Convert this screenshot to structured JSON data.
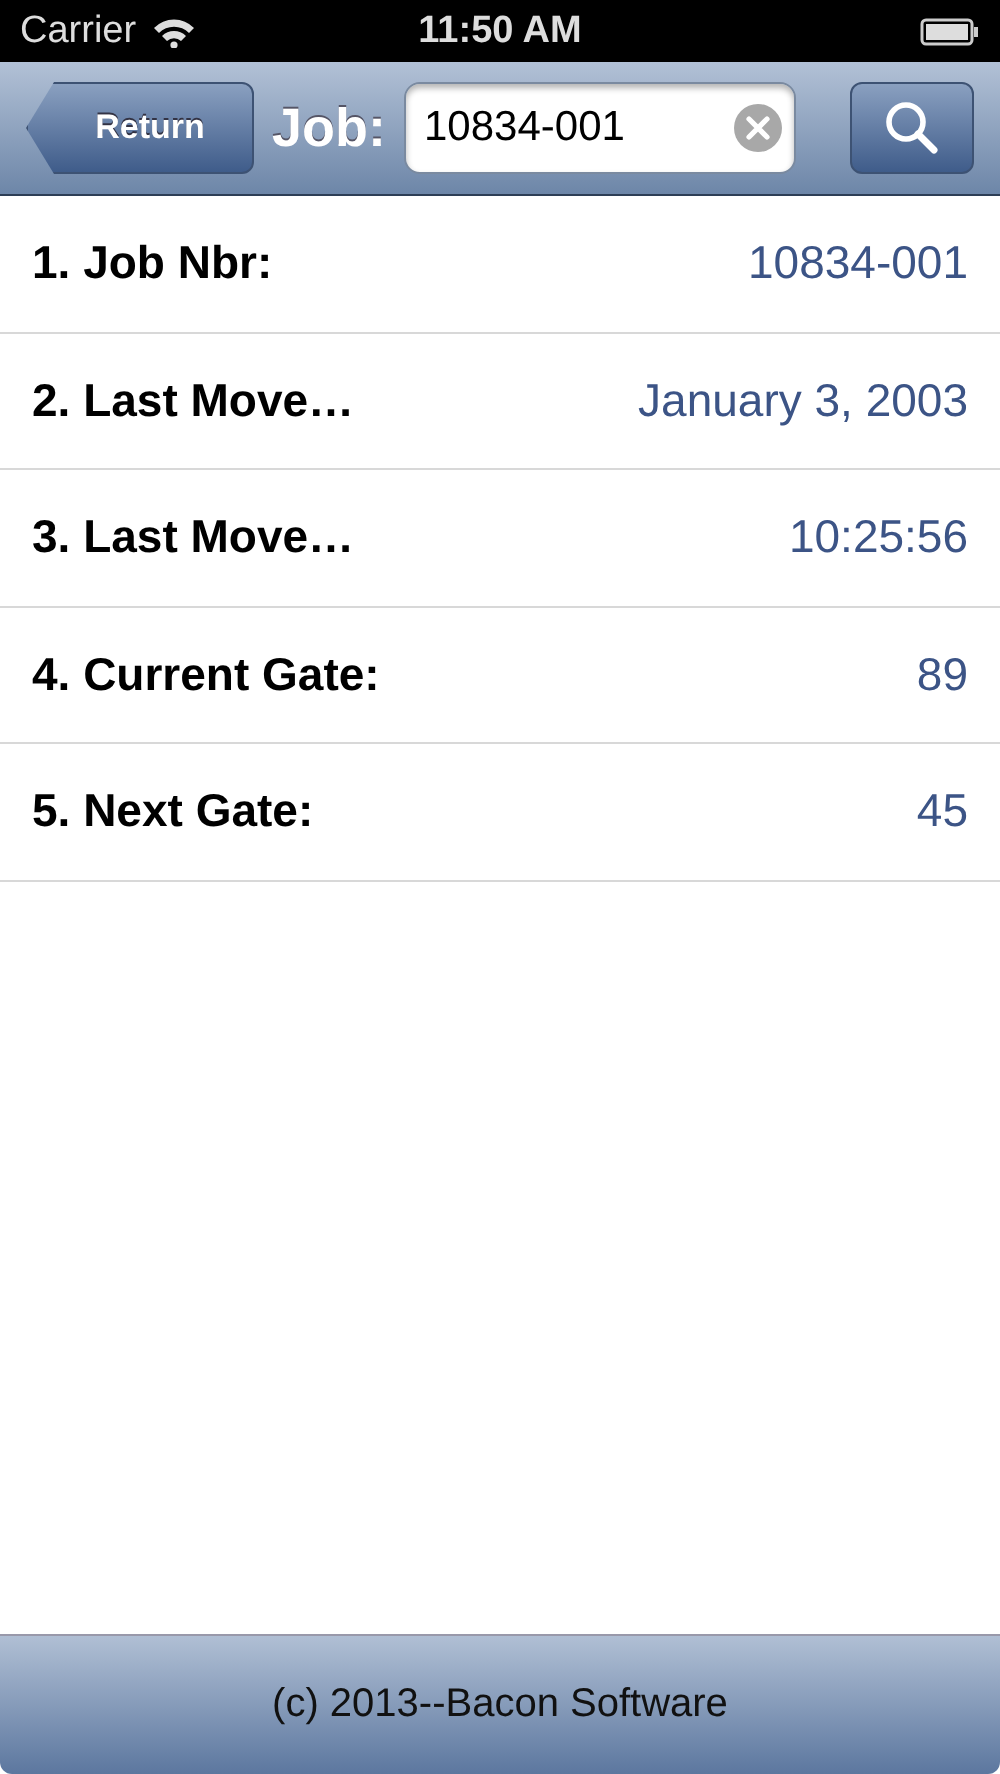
{
  "status_bar": {
    "carrier": "Carrier",
    "time": "11:50 AM"
  },
  "nav_bar": {
    "back_button": "Return",
    "label": "Job:",
    "search_field": {
      "value": "10834-001"
    }
  },
  "rows": [
    {
      "label": "1. Job Nbr:",
      "value": "10834-001"
    },
    {
      "label": "2. Last Move…",
      "value": "January 3, 2003"
    },
    {
      "label": "3. Last Move…",
      "value": "10:25:56"
    },
    {
      "label": "4. Current Gate:",
      "value": "89"
    },
    {
      "label": "5. Next Gate:",
      "value": "45"
    }
  ],
  "footer": {
    "text": "(c) 2013--Bacon Software"
  }
}
